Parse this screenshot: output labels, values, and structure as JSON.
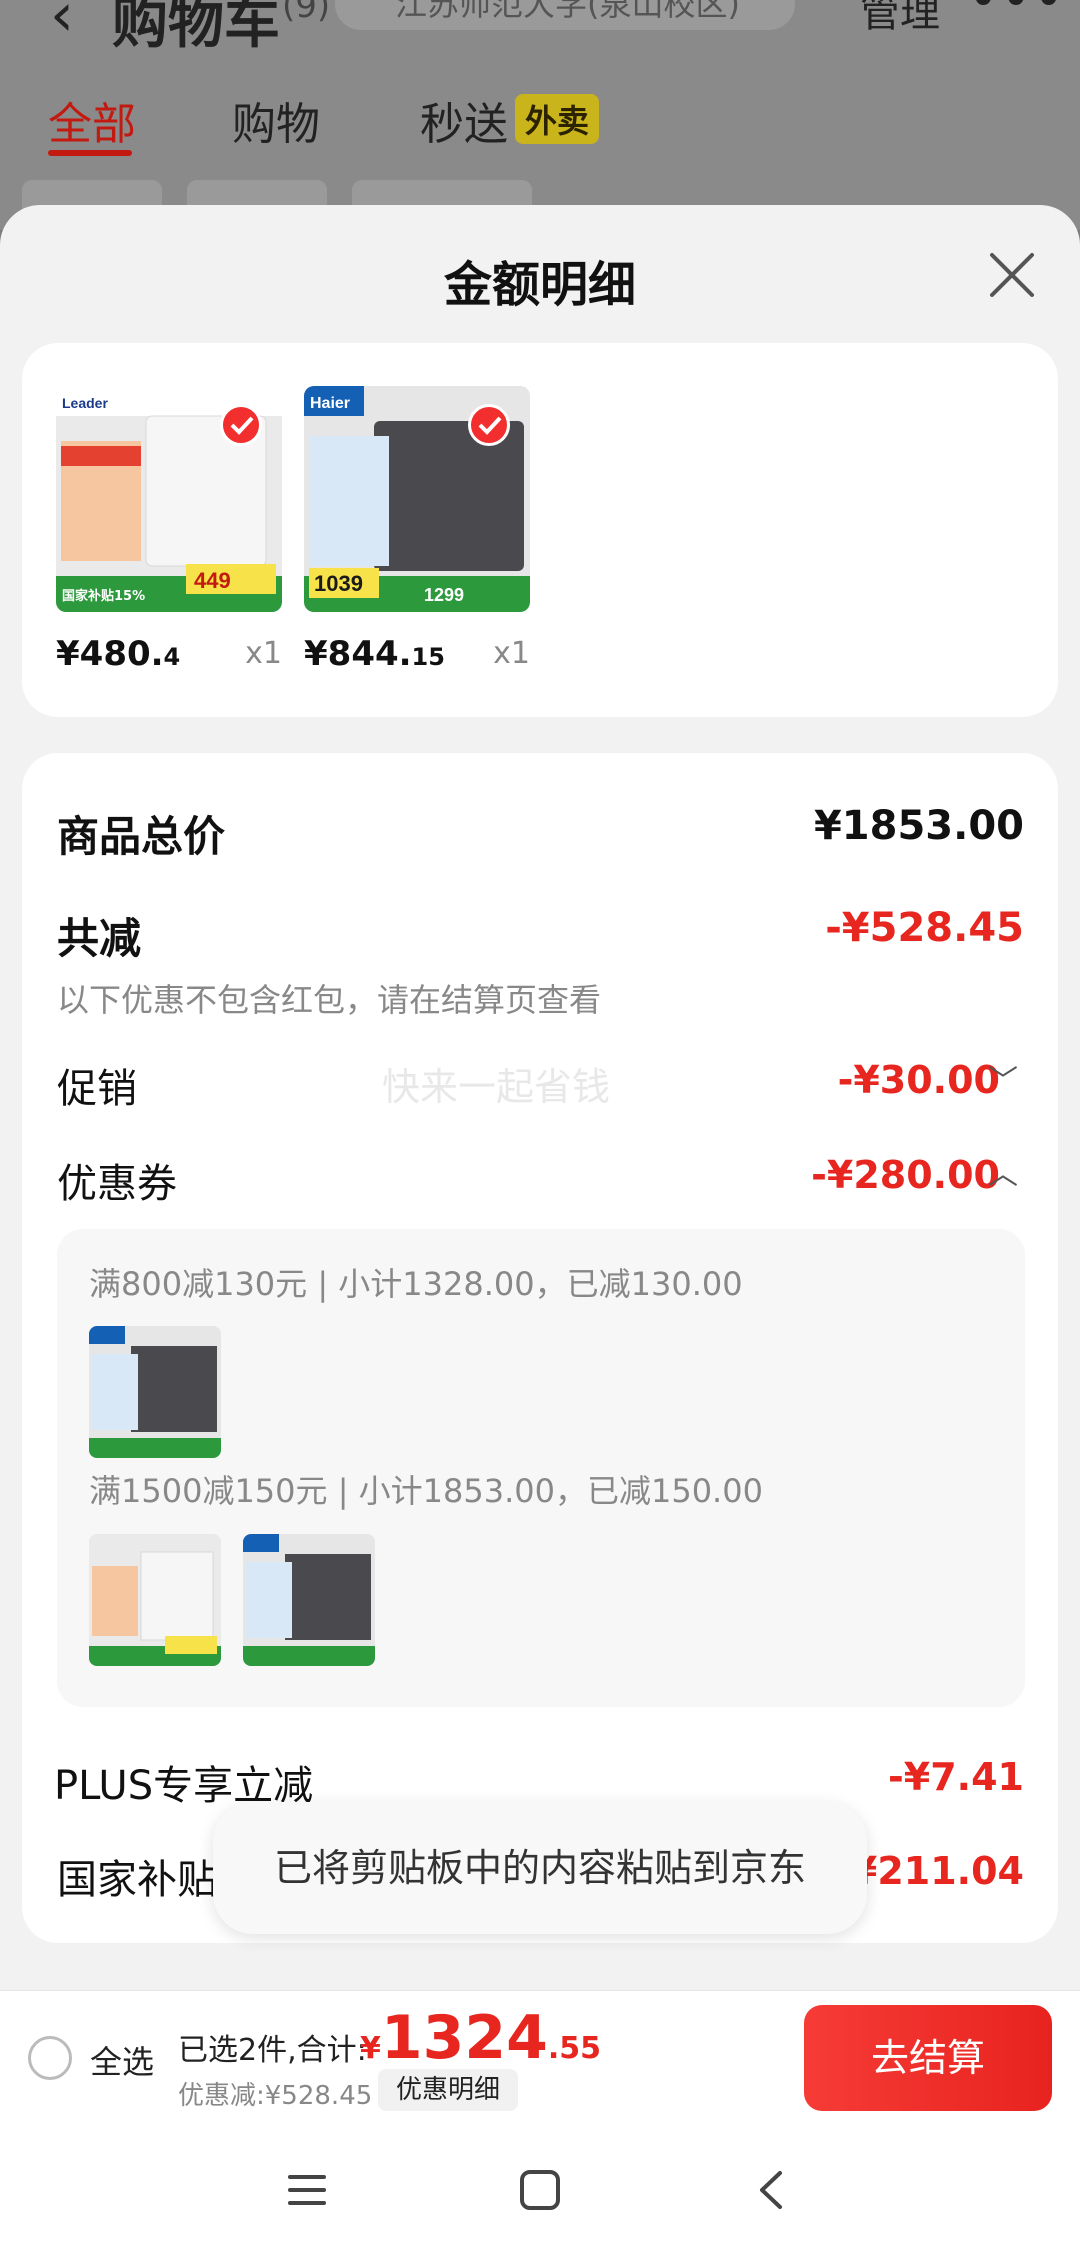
{
  "background": {
    "title": "购物车",
    "count": "(9)",
    "location": "江苏师范大学(泉山校区)",
    "manage": "管理",
    "tabs": [
      "全部",
      "购物",
      "秒送"
    ],
    "tab_badge": "外卖"
  },
  "sheet": {
    "title": "金额明细"
  },
  "products": [
    {
      "price_int": "¥480.",
      "price_dec": "4",
      "qty": "x1",
      "brand": "Leader",
      "promo": "449",
      "subsidy": "国家补贴15%"
    },
    {
      "price_int": "¥844.",
      "price_dec": "15",
      "qty": "x1",
      "brand": "Haier",
      "promo": "1039",
      "orig": "1299"
    }
  ],
  "detail": {
    "subtotal_label": "商品总价",
    "subtotal_value": "¥1853.00",
    "total_discount_label": "共减",
    "total_discount_value": "-¥528.45",
    "note": "以下优惠不包含红包，请在结算页查看",
    "watermark": "快来一起省钱",
    "promo_label": "促销",
    "promo_value": "-¥30.00",
    "coupon_label": "优惠券",
    "coupon_value": "-¥280.00",
    "coupons": [
      {
        "text": "满800减130元 | 小计1328.00，已减130.00"
      },
      {
        "text": "满1500减150元 | 小计1853.00，已减150.00"
      }
    ],
    "plus_label": "PLUS专享立减",
    "plus_value": "-¥7.41",
    "subsidy_label": "国家补贴",
    "subsidy_value": "-¥211.04"
  },
  "toast": "已将剪贴板中的内容粘贴到京东",
  "checkout": {
    "select_all": "全选",
    "summary_prefix": "已选2件,合计:",
    "total_yen": "¥",
    "total_int": "1324",
    "total_dec": ".55",
    "discount_text": "优惠减:¥528.45",
    "detail_chip": "优惠明细",
    "button": "去结算"
  },
  "colors": {
    "accent": "#e6261f",
    "checkout_button": "#f63b36",
    "sheet_bg": "#f2f2f2"
  }
}
